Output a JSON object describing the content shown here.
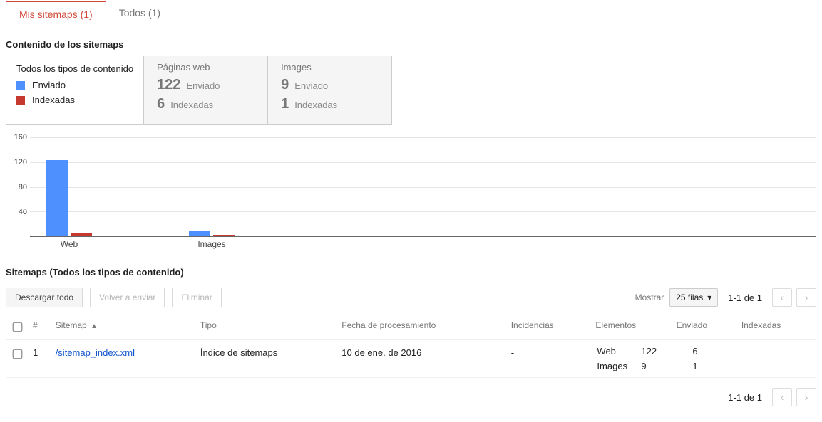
{
  "tabs": {
    "mine": {
      "label": "Mis sitemaps (1)"
    },
    "all": {
      "label": "Todos (1)"
    }
  },
  "content_heading": "Contenido de los sitemaps",
  "legend": {
    "title": "Todos los tipos de contenido",
    "sent": "Enviado",
    "indexed": "Indexadas"
  },
  "cards": {
    "web": {
      "title": "Páginas web",
      "sent_value": "122",
      "sent_label": "Enviado",
      "indexed_value": "6",
      "indexed_label": "Indexadas"
    },
    "images": {
      "title": "Images",
      "sent_value": "9",
      "sent_label": "Enviado",
      "indexed_value": "1",
      "indexed_label": "Indexadas"
    }
  },
  "chart_data": {
    "type": "bar",
    "categories": [
      "Web",
      "Images"
    ],
    "series": [
      {
        "name": "Enviado",
        "values": [
          122,
          9
        ]
      },
      {
        "name": "Indexadas",
        "values": [
          6,
          1
        ]
      }
    ],
    "yticks": [
      40,
      80,
      120,
      160
    ],
    "ylim": [
      0,
      160
    ],
    "title": "",
    "xlabel": "",
    "ylabel": ""
  },
  "table_heading": "Sitemaps (Todos los tipos de contenido)",
  "toolbar": {
    "download": "Descargar todo",
    "resend": "Volver a enviar",
    "delete": "Eliminar",
    "show": "Mostrar",
    "rows": "25 filas",
    "page": "1-1 de 1"
  },
  "columns": {
    "num": "#",
    "sitemap": "Sitemap",
    "type": "Tipo",
    "processed": "Fecha de procesamiento",
    "issues": "Incidencias",
    "elements": "Elementos",
    "sent": "Enviado",
    "indexed": "Indexadas"
  },
  "row": {
    "index": "1",
    "url": "/sitemap_index.xml",
    "type": "Índice de sitemaps",
    "date": "10 de ene. de 2016",
    "issues": "-",
    "el_web_label": "Web",
    "el_web_sent": "122",
    "el_web_indexed": "6",
    "el_img_label": "Images",
    "el_img_sent": "9",
    "el_img_indexed": "1"
  },
  "footer_page": "1-1 de 1"
}
